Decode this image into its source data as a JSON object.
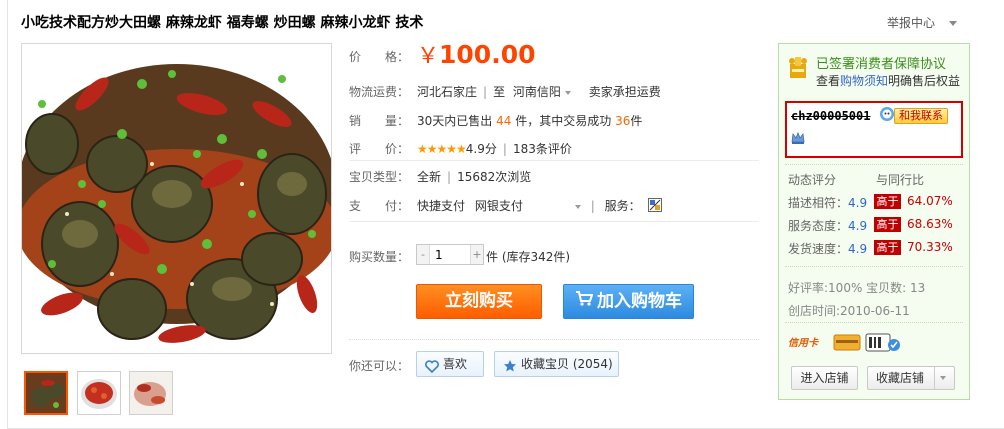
{
  "product": {
    "title": "小吃技术配方炒大田螺 麻辣龙虾 福寿螺 炒田螺 麻辣小龙虾 技术",
    "report_label": "举报中心"
  },
  "price": {
    "label": "价　　格：",
    "currency": "￥",
    "value": "100.00"
  },
  "shipping": {
    "label": "物流运费：",
    "origin": "河北石家庄",
    "to": "至",
    "destination": "河南信阳",
    "note": "卖家承担运费"
  },
  "sales": {
    "label": "销　　量：",
    "prefix": "30天内已售出",
    "sold": "44",
    "mid": "件，其中交易成功",
    "success": "36",
    "suffix": "件"
  },
  "rating": {
    "label": "评　　价：",
    "stars": "★★★★★",
    "score": "4.9分",
    "reviews": "183条评价"
  },
  "item_type": {
    "label": "宝贝类型：",
    "condition": "全新",
    "views": "15682次浏览"
  },
  "payment": {
    "label": "支　　付：",
    "method1": "快捷支付",
    "method2": "网银支付",
    "service_label": "服务："
  },
  "purchase": {
    "qty_label": "购买数量：",
    "minus": "-",
    "quantity": "1",
    "plus": "+",
    "stock": "件 (库存342件)",
    "buy_now": "立刻购买",
    "add_cart": "加入购物车"
  },
  "extras": {
    "label": "你还可以：",
    "like": "喜欢",
    "collect": "收藏宝贝 (2054)"
  },
  "seller": {
    "guarantee_title": "已签署消费者保障协议",
    "guarantee_pre": "查看",
    "guarantee_link": "购物须知",
    "guarantee_post": "明确售后权益",
    "name": "chz00005001",
    "contact": "和我联系",
    "dynamic_label": "动态评分",
    "compare_label": "与同行比",
    "scores": [
      {
        "label": "描述相符：",
        "value": "4.9",
        "tag": "高于",
        "pct": "64.07%"
      },
      {
        "label": "服务态度：",
        "value": "4.9",
        "tag": "高于",
        "pct": "68.63%"
      },
      {
        "label": "发货速度：",
        "value": "4.9",
        "tag": "高于",
        "pct": "70.33%"
      }
    ],
    "praise": "好评率:100% 宝贝数: 13",
    "created": "创店时间:2010-06-11",
    "enter_shop": "进入店铺",
    "collect_shop": "收藏店铺"
  },
  "colors": {
    "price": "#ff4400",
    "buy_button": "#ff6a00",
    "cart_button": "#2c8ae0",
    "seller_border": "#d40000",
    "sidebar_bg": "#f5fcf0"
  }
}
